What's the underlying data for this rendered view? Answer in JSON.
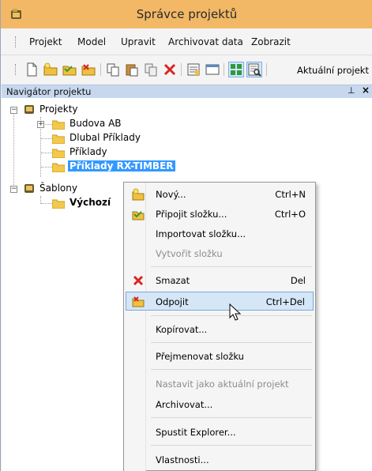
{
  "window": {
    "title": "Správce projektů"
  },
  "menubar": {
    "items": [
      "Projekt",
      "Model",
      "Upravit",
      "Archivovat data",
      "Zobrazit"
    ]
  },
  "toolbar": {
    "icons": [
      "new-document-icon",
      "new-folder-icon",
      "open-folder-icon",
      "disconnect-folder-icon",
      "copy-icon",
      "paste-icon",
      "duplicate-icon",
      "delete-icon",
      "properties-icon",
      "window-icon",
      "list-view-icon",
      "details-view-icon"
    ],
    "current_project_label": "Aktuální projekt"
  },
  "panel": {
    "title": "Navigátor projektu",
    "pin": "⊥",
    "close": "×"
  },
  "tree": {
    "projects_root": "Projekty",
    "projects": [
      "Budova AB",
      "Dlubal Příklady",
      "Příklady",
      "Příklady RX-TIMBER"
    ],
    "selected": "Příklady RX-TIMBER",
    "templates_root": "Šablony",
    "templates": [
      "Výchozí"
    ]
  },
  "context_menu": {
    "items": [
      {
        "label": "Nový...",
        "shortcut": "Ctrl+N",
        "icon": "new-folder-icon",
        "disabled": false
      },
      {
        "label": "Připojit složku...",
        "shortcut": "Ctrl+O",
        "icon": "connect-folder-icon",
        "disabled": false
      },
      {
        "label": "Importovat složku...",
        "shortcut": "",
        "icon": "",
        "disabled": false
      },
      {
        "label": "Vytvořit složku",
        "shortcut": "",
        "icon": "",
        "disabled": true
      },
      {
        "label": "Smazat",
        "shortcut": "Del",
        "icon": "delete-icon",
        "disabled": false
      },
      {
        "label": "Odpojit",
        "shortcut": "Ctrl+Del",
        "icon": "disconnect-folder-icon",
        "disabled": false,
        "highlighted": true
      },
      {
        "label": "Kopírovat...",
        "shortcut": "",
        "icon": "",
        "disabled": false
      },
      {
        "label": "Přejmenovat složku",
        "shortcut": "",
        "icon": "",
        "disabled": false
      },
      {
        "label": "Nastavit jako aktuální projekt",
        "shortcut": "",
        "icon": "",
        "disabled": true
      },
      {
        "label": "Archivovat...",
        "shortcut": "",
        "icon": "",
        "disabled": false
      },
      {
        "label": "Spustit Explorer...",
        "shortcut": "",
        "icon": "",
        "disabled": false
      },
      {
        "label": "Vlastnosti...",
        "shortcut": "",
        "icon": "",
        "disabled": false
      }
    ]
  },
  "colors": {
    "titlebar": "#f2b866",
    "selection": "#3399ff",
    "menu_hover": "#d5e6f7",
    "panel_header": "#c6d7ee"
  }
}
